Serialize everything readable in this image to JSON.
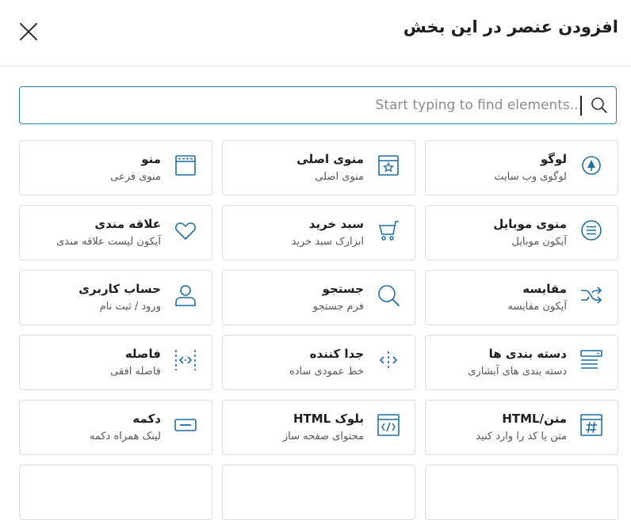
{
  "dialog": {
    "title": "افزودن عنصر در این بخش",
    "search_placeholder": "Start typing to find elements..."
  },
  "colors": {
    "accent": "#2a7fb0",
    "icon": "#1d6fa3"
  },
  "cards": [
    {
      "name": "لوگو",
      "desc": "لوگوی وب سایت",
      "icon": "logo-icon"
    },
    {
      "name": "منوی اصلی",
      "desc": "منوی اصلی",
      "icon": "main-menu-icon"
    },
    {
      "name": "منو",
      "desc": "منوی فرعی",
      "icon": "menu-window-icon"
    },
    {
      "name": "منوی موبایل",
      "desc": "آیکون موبایل",
      "icon": "mobile-menu-icon"
    },
    {
      "name": "سبد خرید",
      "desc": "ابزارک سبد خرید",
      "icon": "cart-icon"
    },
    {
      "name": "علاقه مندی",
      "desc": "آیکون لیست علاقه مندی",
      "icon": "heart-icon"
    },
    {
      "name": "مقایسه",
      "desc": "آیکون مقایسه",
      "icon": "compare-icon"
    },
    {
      "name": "جستجو",
      "desc": "فرم جستجو",
      "icon": "search-icon"
    },
    {
      "name": "حساب کاربری",
      "desc": "ورود / ثبت نام",
      "icon": "user-icon"
    },
    {
      "name": "دسته بندی ها",
      "desc": "دسته بندی های آبشاری",
      "icon": "categories-icon"
    },
    {
      "name": "جدا کننده",
      "desc": "خط عمودی ساده",
      "icon": "divider-icon"
    },
    {
      "name": "فاصله",
      "desc": "فاصله افقی",
      "icon": "spacer-icon"
    },
    {
      "name": "متن/HTML",
      "desc": "متن یا کد را وارد کنید",
      "icon": "text-html-icon"
    },
    {
      "name": "بلوک HTML",
      "desc": "محتوای صفحه ساز",
      "icon": "html-block-icon"
    },
    {
      "name": "دکمه",
      "desc": "لینک همراه دکمه",
      "icon": "button-icon"
    }
  ]
}
